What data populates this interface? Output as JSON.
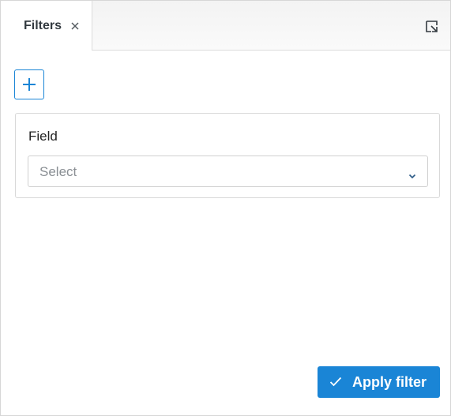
{
  "tabs": [
    {
      "label": "Filters",
      "active": true
    }
  ],
  "add_button": {
    "icon": "plus-icon"
  },
  "field": {
    "label": "Field",
    "select": {
      "value": "",
      "placeholder": "Select"
    }
  },
  "apply_button": {
    "label": "Apply filter",
    "icon": "check-icon"
  },
  "colors": {
    "accent": "#1a85d6",
    "text": "#333a40",
    "placeholder": "#8a8f94",
    "border": "#d9d9d9"
  }
}
